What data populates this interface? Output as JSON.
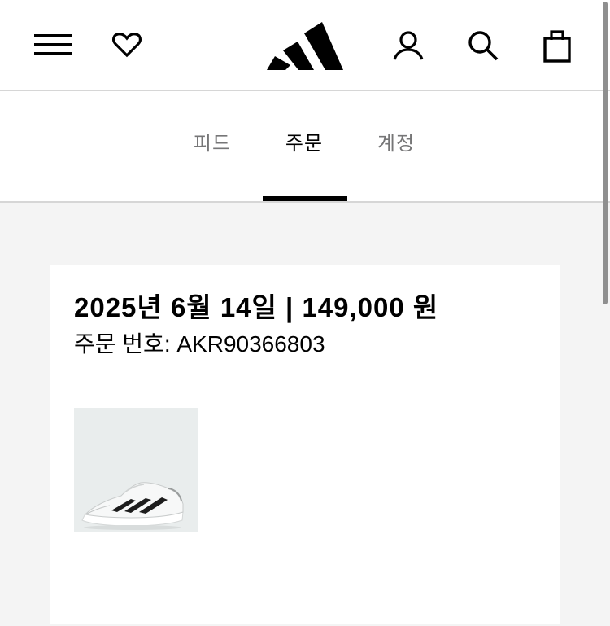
{
  "header": {
    "icons": {
      "menu": "hamburger-menu-icon",
      "wishlist": "heart-icon",
      "logo": "brand-logo",
      "account": "user-icon",
      "search": "search-icon",
      "bag": "shopping-bag-icon"
    }
  },
  "tabs": [
    {
      "label": "피드",
      "active": false
    },
    {
      "label": "주문",
      "active": true
    },
    {
      "label": "계정",
      "active": false
    }
  ],
  "order": {
    "title": "2025년 6월 14일 | 149,000 원",
    "number_label": "주문 번호: AKR90366803",
    "product_image": "white-running-shoe-with-black-stripes"
  },
  "colors": {
    "background": "#f4f4f4",
    "card": "#ffffff",
    "text_primary": "#000000",
    "text_inactive": "#767677",
    "divider": "#d6d6d6",
    "thumb_bg": "#e9eded"
  }
}
